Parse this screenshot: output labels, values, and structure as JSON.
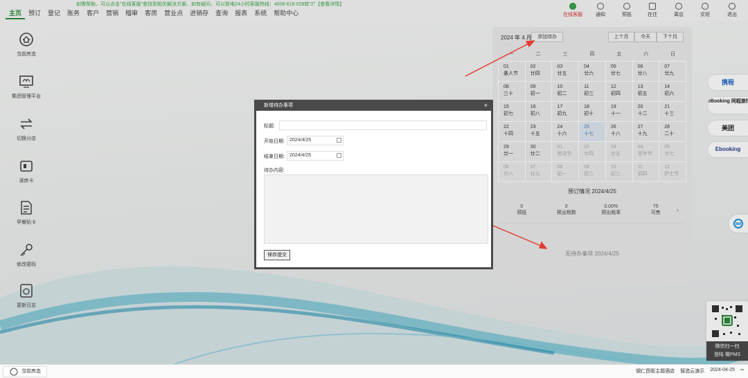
{
  "notice": "如需帮助、可以点击\"在线客服\"查找到相关解决方案、如有疑问、可以致电24小时客服热线：4008-618-028转\"2\"【查看详情】",
  "menu": [
    "主页",
    "预订",
    "登记",
    "账务",
    "客户",
    "营销",
    "稽审",
    "客房",
    "营业点",
    "进销存",
    "查询",
    "报表",
    "系统",
    "帮助中心"
  ],
  "top_icons": [
    "在线客服",
    "通知",
    "预抵",
    "在住",
    "离店",
    "交班",
    "退出"
  ],
  "sidebar": [
    "当前房态",
    "集团管理平台",
    "切换分店",
    "读房卡",
    "早餐贴卡",
    "修改密码",
    "更新日志"
  ],
  "calendar": {
    "month_label": "2024 年 4 月",
    "add_todo": "添加待办",
    "prev": "上个月",
    "today": "今天",
    "next": "下个月",
    "weekdays": [
      "一",
      "二",
      "三",
      "四",
      "五",
      "六",
      "日"
    ],
    "days": [
      [
        "01",
        "愚人节"
      ],
      [
        "02",
        "廿四"
      ],
      [
        "03",
        "廿五"
      ],
      [
        "04",
        "廿六"
      ],
      [
        "05",
        "廿七"
      ],
      [
        "06",
        "廿八"
      ],
      [
        "07",
        "廿九"
      ],
      [
        "08",
        "三十"
      ],
      [
        "09",
        "初一"
      ],
      [
        "10",
        "初二"
      ],
      [
        "11",
        "初三"
      ],
      [
        "12",
        "初四"
      ],
      [
        "13",
        "初五"
      ],
      [
        "14",
        "初六"
      ],
      [
        "15",
        "初七"
      ],
      [
        "16",
        "初八"
      ],
      [
        "17",
        "初九"
      ],
      [
        "18",
        "初十"
      ],
      [
        "19",
        "十一"
      ],
      [
        "20",
        "十二"
      ],
      [
        "21",
        "十三"
      ],
      [
        "22",
        "十四"
      ],
      [
        "23",
        "十五"
      ],
      [
        "24",
        "十六"
      ],
      [
        "25",
        "十七"
      ],
      [
        "26",
        "十八"
      ],
      [
        "27",
        "十九"
      ],
      [
        "28",
        "二十"
      ],
      [
        "29",
        "廿一"
      ],
      [
        "30",
        "廿二"
      ],
      [
        "01",
        "劳动节"
      ],
      [
        "02",
        "廿四"
      ],
      [
        "03",
        "廿五"
      ],
      [
        "04",
        "青年节"
      ],
      [
        "05",
        "廿七"
      ],
      [
        "06",
        "廿八"
      ],
      [
        "07",
        "廿九"
      ],
      [
        "08",
        "初一"
      ],
      [
        "09",
        "初二"
      ],
      [
        "10",
        "初三"
      ],
      [
        "11",
        "初四"
      ],
      [
        "12",
        "护士节"
      ]
    ],
    "today_index": 24,
    "dim_from": 30
  },
  "booking": {
    "title": "预订情况 2024/4/25",
    "stats": [
      [
        "0",
        "预抵"
      ],
      [
        "0",
        "预出租数"
      ],
      [
        "0.00%",
        "预出租率"
      ],
      [
        "75",
        "可售"
      ]
    ],
    "no_todo": "无待办事项 2024/4/25"
  },
  "modal": {
    "title": "新增待办事项",
    "close": "×",
    "label_title": "标题:",
    "label_start": "开始日期:",
    "start_value": "2024/4/25",
    "label_end": "结束日期:",
    "end_value": "2024/4/25",
    "label_content": "待办内容:",
    "submit": "保存提交"
  },
  "right_tools": [
    "携程",
    "eBooking 同程旅行",
    "美团",
    "Ebooking"
  ],
  "qr": {
    "line1": "微信扫一扫",
    "line2": "登陆 微PMS"
  },
  "footer": {
    "tab": "当前房态",
    "hotel": "钢仁西街主题酒店",
    "user": "智选云演示",
    "date": "2024-04-25"
  },
  "colors": {
    "brand": "#2e8b3a",
    "alert": "#d0312d"
  }
}
